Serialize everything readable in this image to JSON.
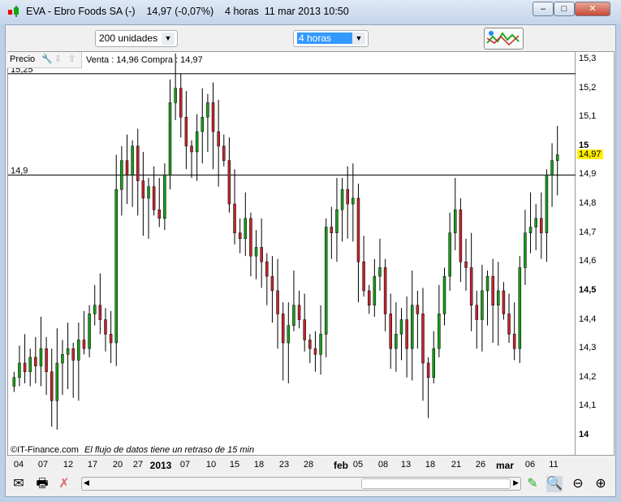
{
  "window": {
    "title": "EVA - Ebro Foods SA (-)",
    "price": "14,97 (-0,07%)",
    "period": "4 horas",
    "datetime": "11 mar 2013 10:50",
    "minimize": "‒",
    "maximize": "□",
    "close": "✕"
  },
  "toolbar": {
    "units_value": "200 unidades",
    "period_value": "4 horas"
  },
  "infobar": {
    "label": "Precio",
    "quote": "Venta : 14,96 Compra : 14,97"
  },
  "footer": {
    "copyright": "©IT-Finance.com",
    "notice": "El flujo de datos tiene un retraso de 15 min"
  },
  "colors": {
    "up": "#1a9a1a",
    "down": "#c0262e",
    "current": "#ffee00"
  },
  "chart_data": {
    "type": "candlestick",
    "title": "EVA - Ebro Foods SA",
    "ylim": [
      13.98,
      15.32
    ],
    "yticks": [
      "15,3",
      "15,2",
      "15,1",
      "15",
      "14,9",
      "14,8",
      "14,7",
      "14,6",
      "14,5",
      "14,4",
      "14,3",
      "14,2",
      "14,1",
      "14"
    ],
    "ytick_values": [
      15.3,
      15.2,
      15.1,
      15.0,
      14.9,
      14.8,
      14.7,
      14.6,
      14.5,
      14.4,
      14.3,
      14.2,
      14.1,
      14.0
    ],
    "xticks": [
      "04",
      "07",
      "12",
      "17",
      "20",
      "27",
      "2013",
      "07",
      "10",
      "15",
      "18",
      "23",
      "28",
      "feb",
      "05",
      "08",
      "13",
      "18",
      "21",
      "26",
      "mar",
      "06",
      "11"
    ],
    "hlines": [
      {
        "value": 15.25,
        "label": "15,25"
      },
      {
        "value": 14.9,
        "label": "14,9"
      }
    ],
    "current_price": {
      "value": 14.97,
      "label": "14,97"
    },
    "closes": [
      14.2,
      14.25,
      14.22,
      14.27,
      14.24,
      14.3,
      14.22,
      14.12,
      14.25,
      14.28,
      14.3,
      14.26,
      14.33,
      14.3,
      14.42,
      14.45,
      14.4,
      14.35,
      14.32,
      14.85,
      14.95,
      14.9,
      15.0,
      14.88,
      14.82,
      14.86,
      14.78,
      14.75,
      14.9,
      15.15,
      15.2,
      15.1,
      15.0,
      14.98,
      15.05,
      15.1,
      15.15,
      15.05,
      15.0,
      14.95,
      14.8,
      14.7,
      14.68,
      14.75,
      14.62,
      14.65,
      14.6,
      14.55,
      14.5,
      14.42,
      14.32,
      14.38,
      14.45,
      14.4,
      14.33,
      14.3,
      14.28,
      14.35,
      14.72,
      14.7,
      14.78,
      14.85,
      14.8,
      14.82,
      14.6,
      14.5,
      14.45,
      14.55,
      14.58,
      14.42,
      14.3,
      14.35,
      14.4,
      14.3,
      14.45,
      14.42,
      14.25,
      14.2,
      14.3,
      14.42,
      14.55,
      14.7,
      14.78,
      14.6,
      14.58,
      14.45,
      14.4,
      14.5,
      14.55,
      14.45,
      14.5,
      14.42,
      14.35,
      14.3,
      14.58,
      14.7,
      14.72,
      14.75,
      14.7,
      14.9,
      14.95,
      14.97
    ]
  }
}
